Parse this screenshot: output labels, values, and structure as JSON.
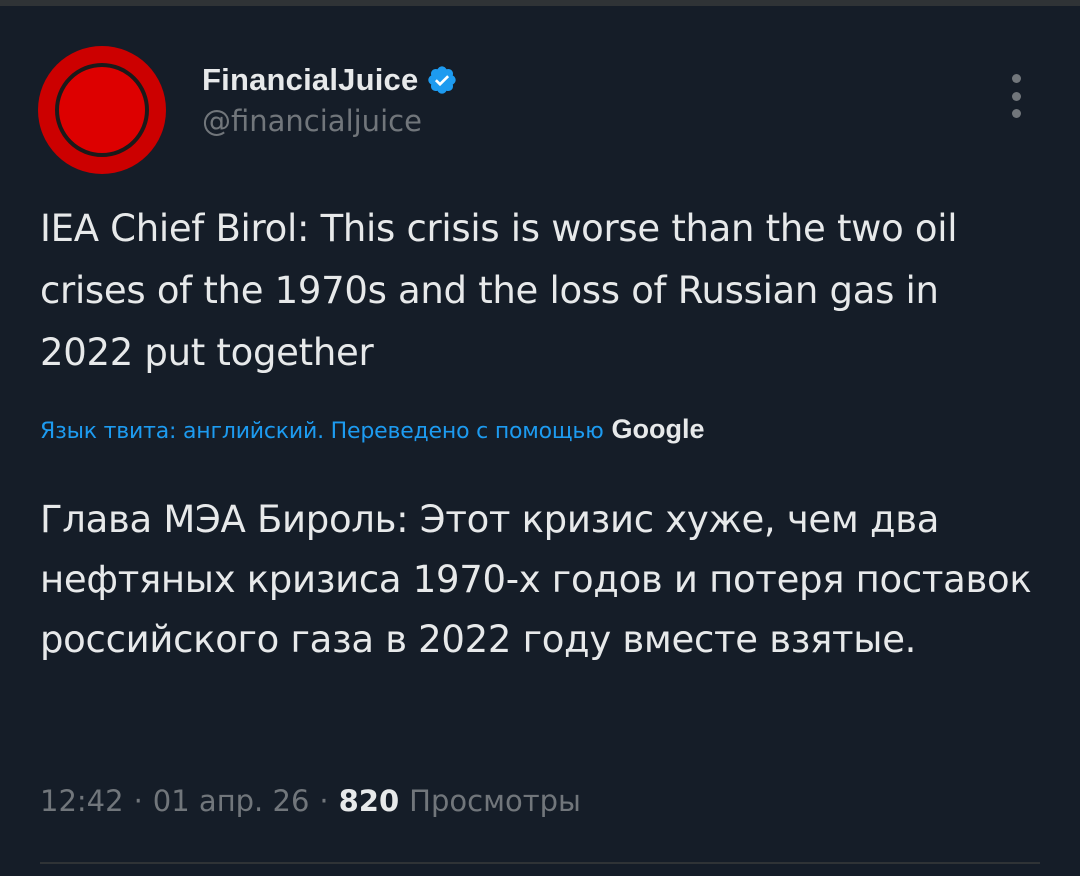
{
  "author": {
    "display_name": "FinancialJuice",
    "handle": "@financialjuice",
    "verified": true,
    "avatar_icon": "red-circle-logo"
  },
  "tweet": {
    "text": "IEA Chief Birol: This crisis is worse than the two oil crises of the 1970s and the loss of Russian gas in 2022 put together",
    "translate_label": "Язык твита: английский. Переведено с помощью",
    "translate_provider": "Google",
    "translated_text": "Глава МЭА Бироль: Этот кризис хуже, чем два нефтяных кризиса 1970-х годов и потеря поставок российского газа в 2022 году вместе взятые."
  },
  "meta": {
    "time": "12:42",
    "separator": "·",
    "date": "01 апр. 26",
    "views_count": "820",
    "views_label": "Просмотры"
  },
  "colors": {
    "background": "#151d28",
    "text": "#e7e9ea",
    "secondary": "#71767b",
    "accent": "#1d9bf0",
    "avatar_red": "#cc0000"
  }
}
